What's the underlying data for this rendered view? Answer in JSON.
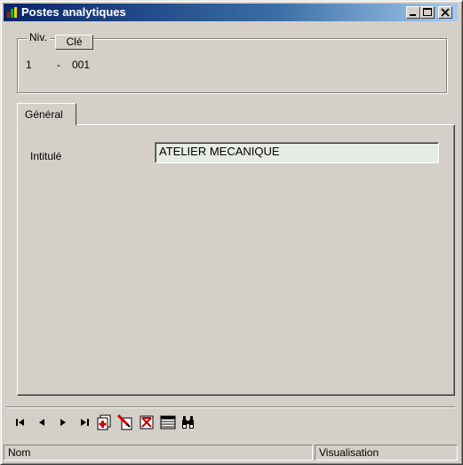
{
  "window": {
    "title": "Postes analytiques"
  },
  "key_section": {
    "niv_label": "Niv.",
    "cle_label": "Clé",
    "niv_value": "1",
    "separator": "-",
    "cle_value": "001"
  },
  "tabs": [
    {
      "label": "Général",
      "active": true
    }
  ],
  "general": {
    "intitule_label": "Intitulé",
    "intitule_value": "ATELIER MECANIQUE"
  },
  "toolbar": {
    "buttons": [
      "first-record",
      "previous-record",
      "next-record",
      "last-record",
      "new-record",
      "edit-record",
      "delete-record",
      "list-view",
      "search"
    ]
  },
  "statusbar": {
    "field_name": "Nom",
    "mode": "Visualisation"
  },
  "colors": {
    "titlebar_start": "#0a246a",
    "titlebar_end": "#a6caf0",
    "face": "#d4d0c8",
    "input_bg": "#e6ece4",
    "icon_red": "#cc0000"
  }
}
